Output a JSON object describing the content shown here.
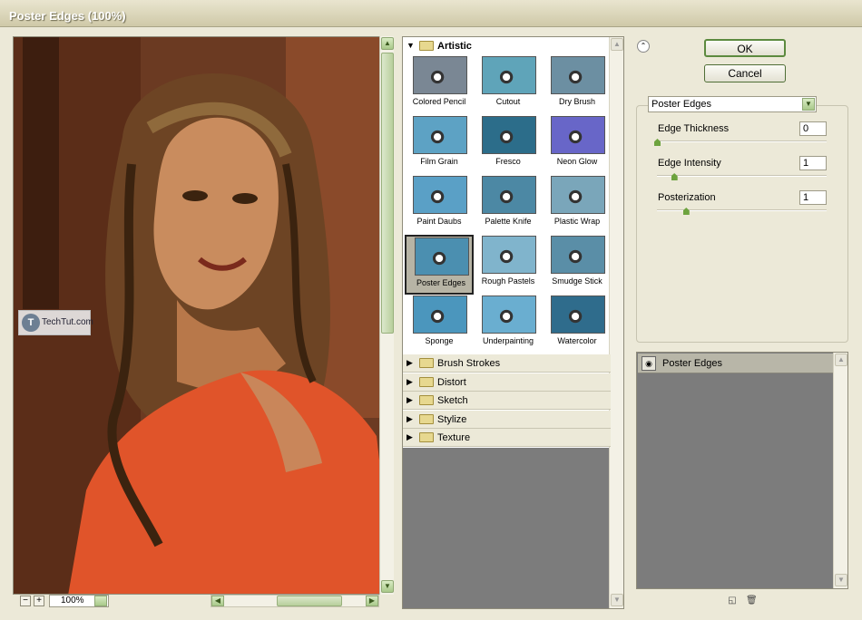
{
  "window": {
    "title": "Poster Edges (100%)"
  },
  "preview": {
    "zoom": "100%",
    "watermark": {
      "logo_letter": "T",
      "text": "TechTut.com"
    }
  },
  "gallery": {
    "open_category": "Artistic",
    "filters": [
      {
        "label": "Colored Pencil",
        "color": "#7a8794"
      },
      {
        "label": "Cutout",
        "color": "#5fa4b9"
      },
      {
        "label": "Dry Brush",
        "color": "#6c8fa2"
      },
      {
        "label": "Film Grain",
        "color": "#5da2c4"
      },
      {
        "label": "Fresco",
        "color": "#2c6d8a"
      },
      {
        "label": "Neon Glow",
        "color": "#6866c8"
      },
      {
        "label": "Paint Daubs",
        "color": "#5aa0c6"
      },
      {
        "label": "Palette Knife",
        "color": "#4c88a4"
      },
      {
        "label": "Plastic Wrap",
        "color": "#7aa6ba"
      },
      {
        "label": "Poster Edges",
        "color": "#4b8fb0"
      },
      {
        "label": "Rough Pastels",
        "color": "#80b4cc"
      },
      {
        "label": "Smudge Stick",
        "color": "#5a8ea7"
      },
      {
        "label": "Sponge",
        "color": "#4b96bd"
      },
      {
        "label": "Underpainting",
        "color": "#6aaed0"
      },
      {
        "label": "Watercolor",
        "color": "#2f6c8c"
      }
    ],
    "selected": "Poster Edges",
    "collapsed_categories": [
      "Brush Strokes",
      "Distort",
      "Sketch",
      "Stylize",
      "Texture"
    ]
  },
  "buttons": {
    "ok": "OK",
    "cancel": "Cancel"
  },
  "settings": {
    "filter_name": "Poster Edges",
    "params": [
      {
        "label": "Edge Thickness",
        "value": "0",
        "slider_fraction": 0.0
      },
      {
        "label": "Edge Intensity",
        "value": "1",
        "slider_fraction": 0.1
      },
      {
        "label": "Posterization",
        "value": "1",
        "slider_fraction": 0.17
      }
    ]
  },
  "layers": [
    {
      "name": "Poster Edges",
      "visible": true
    }
  ]
}
